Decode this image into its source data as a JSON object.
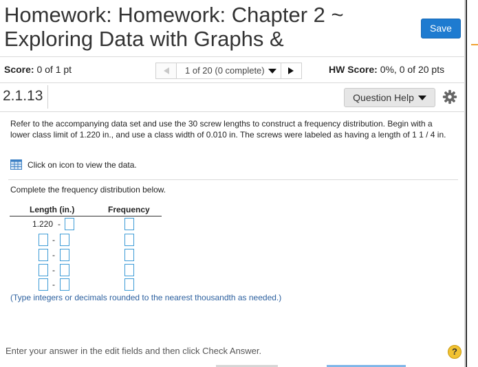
{
  "header": {
    "title": "Homework: Homework: Chapter 2 ~ Exploring Data with Graphs &",
    "save_label": "Save"
  },
  "scorebar": {
    "score_label": "Score:",
    "score_value": "0 of 1 pt",
    "nav_selector": "1 of 20 (0 complete)",
    "hw_score_label": "HW Score:",
    "hw_score_value": "0%, 0 of 20 pts"
  },
  "question": {
    "number": "2.1.13",
    "help_label": "Question Help",
    "intro": "Refer to the accompanying data set and use the 30 screw lengths to construct a frequency distribution. Begin with a lower class limit of 1.220 in., and use a class width of 0.010 in. The screws were labeled as having a length of 1 1 / 4 in.",
    "data_link": "Click on icon to view the data.",
    "instruction": "Complete the frequency distribution below.",
    "table": {
      "col1_header": "Length (in.)",
      "col2_header": "Frequency",
      "first_lower": "1.220",
      "dash": "-"
    },
    "note": "(Type integers or decimals rounded to the nearest thousandth as needed.)"
  },
  "footer": {
    "text": "Enter your answer in the edit fields and then click Check Answer.",
    "help_symbol": "?"
  },
  "colors": {
    "accent": "#1e7bd0",
    "input_border": "#3c9bd6",
    "help_yellow": "#f1c232"
  }
}
